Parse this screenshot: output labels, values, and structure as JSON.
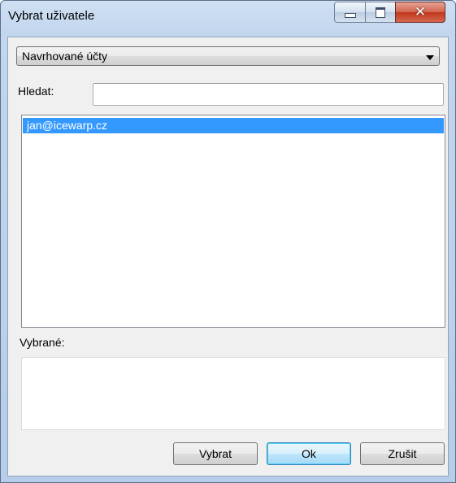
{
  "window": {
    "title": "Vybrat uživatele"
  },
  "titlebar_buttons": {
    "minimize": "minimize-icon",
    "maximize": "maximize-icon",
    "close": "close-icon"
  },
  "account_select": {
    "value": "Navrhované účty"
  },
  "search": {
    "label": "Hledat:",
    "value": ""
  },
  "users_list": {
    "items": [
      {
        "label": "jan@icewarp.cz",
        "selected": true
      }
    ]
  },
  "selected_section": {
    "label": "Vybrané:",
    "items": []
  },
  "buttons": {
    "select": "Vybrat",
    "ok": "Ok",
    "cancel": "Zrušit"
  },
  "colors": {
    "selection": "#3399ff",
    "close_button": "#c0371d"
  }
}
